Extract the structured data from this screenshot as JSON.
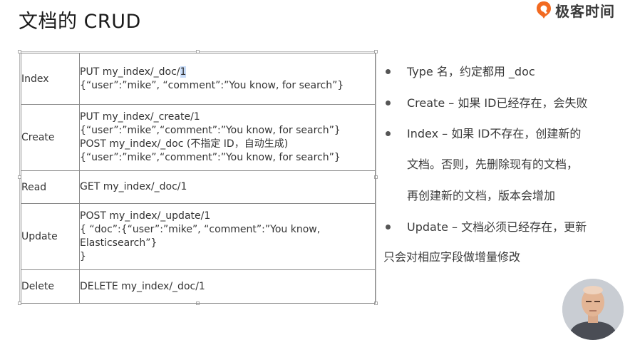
{
  "slide": {
    "title": "文档的 CRUD"
  },
  "brand": {
    "name": "极客时间",
    "color": "#f26a21"
  },
  "table": {
    "rows": [
      {
        "op": "Index",
        "lines": [
          "PUT my_index/_doc/",
          "{“user”:”mike”, “comment”:”You know, for search”}"
        ],
        "highlight": "1"
      },
      {
        "op": "Create",
        "lines": [
          "PUT my_index/_create/1",
          "{“user”:”mike”,“comment”:”You know, for search”}",
          "POST my_index/_doc (不指定 ID，自动生成)",
          "{“user”:”mike”,“comment”:”You know, for search”}"
        ]
      },
      {
        "op": "Read",
        "lines": [
          "GET my_index/_doc/1"
        ]
      },
      {
        "op": "Update",
        "lines": [
          "POST my_index/_update/1",
          "{   “doc”:{“user”:”mike”, “comment”:”You know,",
          "Elasticsearch”}",
          "}"
        ]
      },
      {
        "op": "Delete",
        "lines": [
          "DELETE my_index/_doc/1"
        ]
      }
    ]
  },
  "bullets": [
    {
      "text": "Type 名，约定都用 _doc"
    },
    {
      "text": "Create – 如果 ID已经存在，会失败"
    },
    {
      "text": "Index – 如果 ID不存在，创建新的",
      "cont": [
        "文档。否则，先删除现有的文档，",
        "再创建新的文档，版本会增加"
      ]
    },
    {
      "text": "Update – 文档必须已经存在，更新",
      "cont": [
        "只会对相应字段做增量修改"
      ]
    }
  ]
}
